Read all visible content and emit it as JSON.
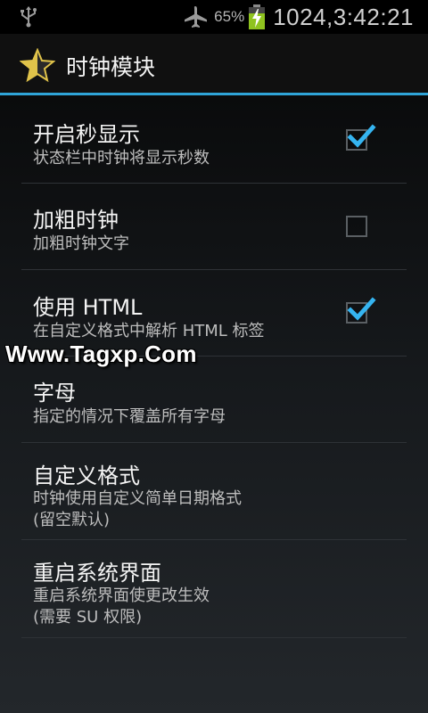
{
  "status_bar": {
    "usb_icon": "usb-icon",
    "airplane_icon": "airplane-icon",
    "battery_percent": "65%",
    "battery_icon": "battery-charging-icon",
    "clock": "1024,3:42:21"
  },
  "action_bar": {
    "app_icon": "star-icon",
    "title": "时钟模块",
    "accent_color": "#2fa4d8"
  },
  "preferences": [
    {
      "title": "开启秒显示",
      "summary_lines": [
        "状态栏中时钟将显示秒数"
      ],
      "checkbox": true,
      "checked": true
    },
    {
      "title": "加粗时钟",
      "summary_lines": [
        "加粗时钟文字"
      ],
      "checkbox": true,
      "checked": false
    },
    {
      "title": "使用 HTML",
      "summary_lines": [
        "在自定义格式中解析 HTML 标签"
      ],
      "checkbox": true,
      "checked": true
    },
    {
      "title": "字母",
      "summary_lines": [
        "指定的情况下覆盖所有字母"
      ],
      "checkbox": false
    },
    {
      "title": "自定义格式",
      "summary_lines": [
        "时钟使用自定义简单日期格式",
        "(留空默认)"
      ],
      "checkbox": false
    },
    {
      "title": "重启系统界面",
      "summary_lines": [
        "重启系统界面使更改生效",
        "(需要 SU 权限)"
      ],
      "checkbox": false
    }
  ],
  "watermark": "Www.Tagxp.Com"
}
